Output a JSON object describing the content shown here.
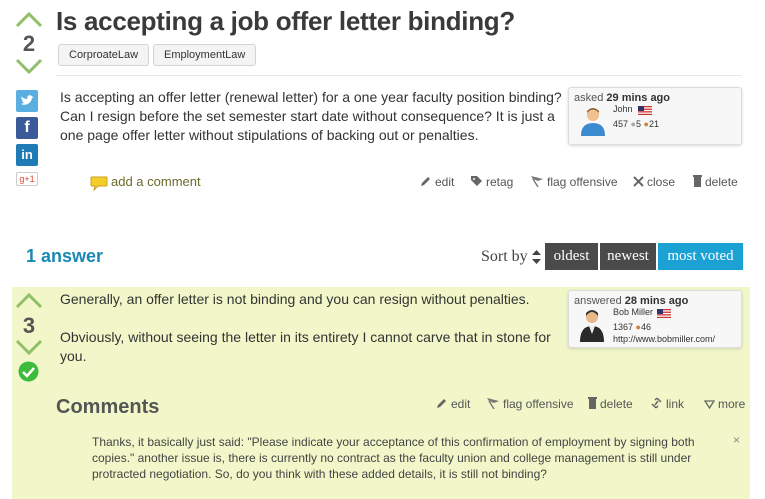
{
  "question": {
    "title": "Is accepting a job offer letter binding?",
    "votes": "2",
    "tags": [
      "CorproateLaw",
      "EmploymentLaw"
    ],
    "body": "Is accepting an offer letter (renewal letter) for a one year faculty position binding? Can I resign before the set semester start date without consequence? It is just a one page offer letter without stipulations of backing out or penalties.",
    "asked_label": "asked",
    "asked_time": "29 mins ago",
    "user": {
      "name": "John",
      "rep": "457",
      "silver": "5",
      "bronze": "21"
    },
    "add_comment": "add a comment",
    "actions": {
      "edit": "edit",
      "retag": "retag",
      "flag": "flag offensive",
      "close": "close",
      "delete": "delete"
    }
  },
  "share": {
    "twitter_icon": "twitter-icon",
    "facebook_icon": "facebook-icon",
    "linkedin_icon": "linkedin-icon",
    "gplus_label": "g+1"
  },
  "answers_header": {
    "count_label": "1 answer",
    "sort_by": "Sort by",
    "sort_options": [
      "oldest",
      "newest",
      "most voted"
    ],
    "active_sort": "most voted"
  },
  "answer": {
    "votes": "3",
    "accepted": true,
    "body_p1": "Generally, an offer letter is not binding and you can resign without penalties.",
    "body_p2": "Obviously, without seeing the letter in its entirety I cannot carve that in stone for you.",
    "answered_label": "answered",
    "answered_time": "28 mins ago",
    "user": {
      "name": "Bob Miller",
      "rep": "1367",
      "bronze": "46",
      "url": "http://www.bobmiller.com/"
    }
  },
  "comments": {
    "title": "Comments",
    "actions": {
      "edit": "edit",
      "flag": "flag offensive",
      "delete": "delete",
      "link": "link",
      "more": "more"
    },
    "items": [
      {
        "text": "Thanks, it basically just said: \"Please indicate your acceptance of this confirmation of employment by signing both copies.\" another issue is, there is currently no contract as the faculty union and college management is still under protracted negotiation. So, do you think with these added details, it is still not binding?",
        "close": "×"
      }
    ]
  },
  "colors": {
    "vote_green": "#7cb342",
    "link_blue": "#1a8ab5",
    "sort_dark": "#4a4a4a",
    "sort_active": "#1ba1d3",
    "answer_bg": "#f2f7c9",
    "twitter": "#5aaee0",
    "facebook": "#3b5a9a",
    "linkedin": "#1f7bb6",
    "gplus": "#dd4b39"
  }
}
